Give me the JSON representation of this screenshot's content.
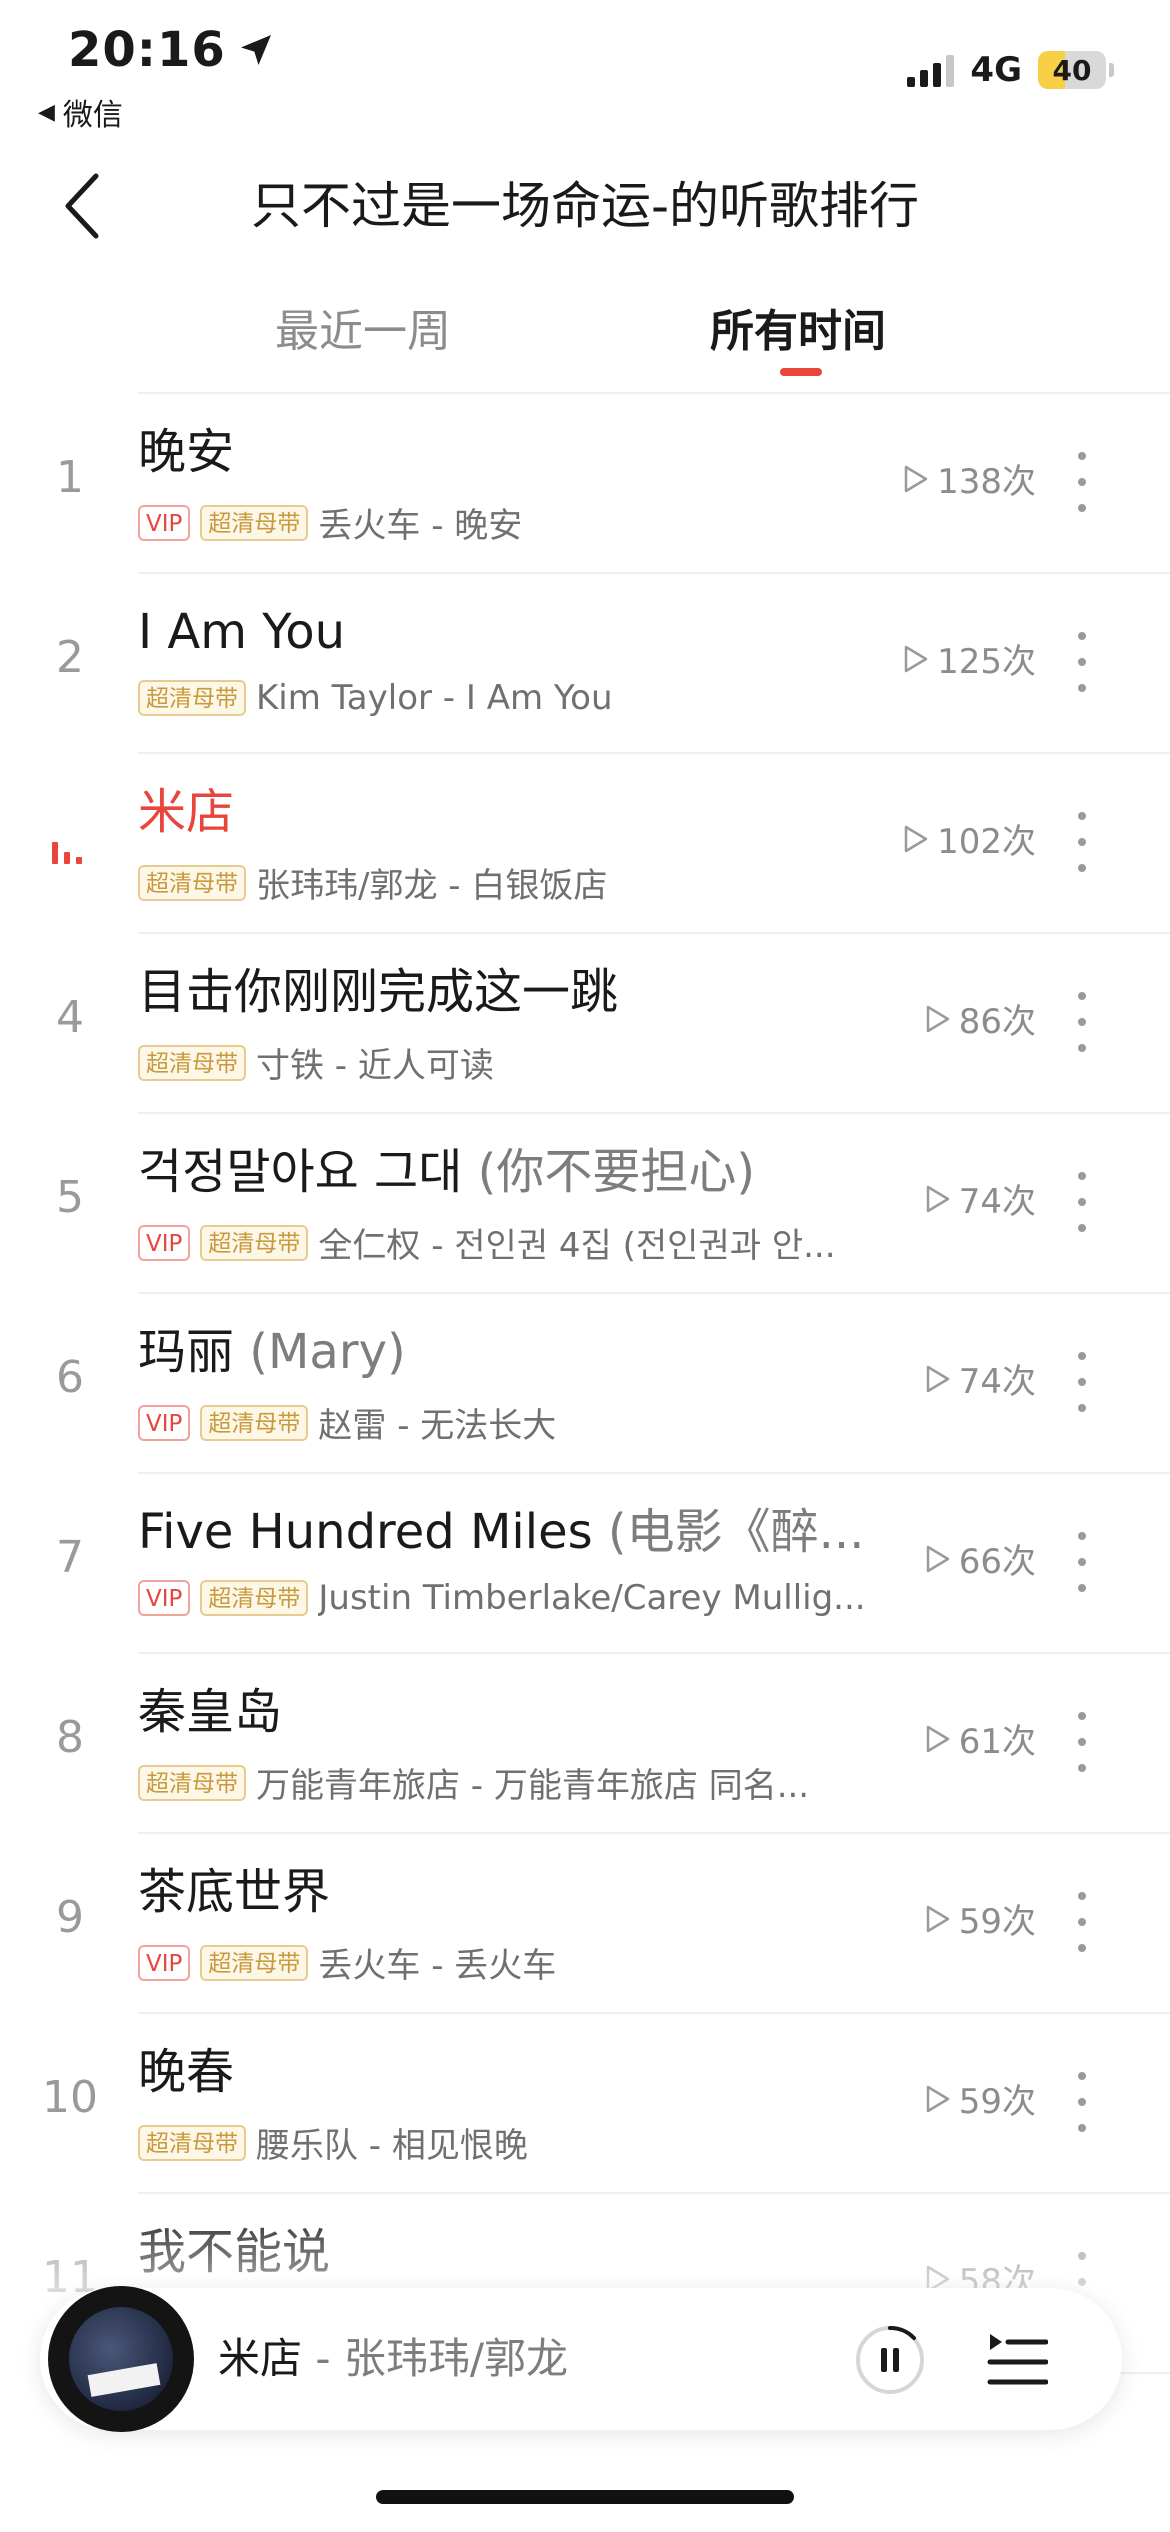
{
  "status_bar": {
    "time": "20:16",
    "back_app": "微信",
    "network": "4G",
    "battery": "40",
    "battery_level": 0.4
  },
  "header": {
    "title": "只不过是一场命运-的听歌排行"
  },
  "tabs": {
    "week": "最近一周",
    "all": "所有时间",
    "selected": "all"
  },
  "songs": [
    {
      "rank": "1",
      "title": "晚安",
      "title_extra": "",
      "vip": true,
      "hq": true,
      "meta": "丢火车 - 晚安",
      "plays": "138次",
      "playing": false
    },
    {
      "rank": "2",
      "title": "I Am You",
      "title_extra": "",
      "vip": false,
      "hq": true,
      "meta": "Kim Taylor - I Am You",
      "plays": "125次",
      "playing": false
    },
    {
      "rank": "3",
      "title": "米店",
      "title_extra": "",
      "vip": false,
      "hq": true,
      "meta": "张玮玮/郭龙 - 白银饭店",
      "plays": "102次",
      "playing": true
    },
    {
      "rank": "4",
      "title": "目击你刚刚完成这一跳",
      "title_extra": "",
      "vip": false,
      "hq": true,
      "meta": "寸铁 - 近人可读",
      "plays": "86次",
      "playing": false
    },
    {
      "rank": "5",
      "title": "걱정말아요 그대",
      "title_extra": " (你不要担心)",
      "vip": true,
      "hq": true,
      "meta": "全仁权 - 전인권 4집 (전인권과 안...",
      "plays": "74次",
      "playing": false
    },
    {
      "rank": "6",
      "title": "玛丽",
      "title_extra": " (Mary)",
      "vip": true,
      "hq": true,
      "meta": "赵雷 - 无法长大",
      "plays": "74次",
      "playing": false
    },
    {
      "rank": "7",
      "title": "Five Hundred Miles",
      "title_extra": " (电影《醉...",
      "vip": true,
      "hq": true,
      "meta": "Justin Timberlake/Carey Mullig...",
      "plays": "66次",
      "playing": false
    },
    {
      "rank": "8",
      "title": "秦皇岛",
      "title_extra": "",
      "vip": false,
      "hq": true,
      "meta": "万能青年旅店 - 万能青年旅店 同名...",
      "plays": "61次",
      "playing": false
    },
    {
      "rank": "9",
      "title": "茶底世界",
      "title_extra": "",
      "vip": true,
      "hq": true,
      "meta": "丢火车 - 丢火车",
      "plays": "59次",
      "playing": false
    },
    {
      "rank": "10",
      "title": "晚春",
      "title_extra": "",
      "vip": false,
      "hq": true,
      "meta": "腰乐队 - 相见恨晚",
      "plays": "59次",
      "playing": false
    },
    {
      "rank": "11",
      "title": "我不能说",
      "title_extra": "",
      "vip": false,
      "hq": false,
      "meta": "",
      "plays": "58次",
      "playing": false
    }
  ],
  "badges": {
    "vip": "VIP",
    "hq": "超清母带"
  },
  "player": {
    "song": "米店",
    "separator": " - ",
    "artist": "张玮玮/郭龙"
  },
  "colors": {
    "accent": "#e8453c",
    "hq_badge": "#c99a3c",
    "muted_text": "#8c8c8c"
  },
  "icons": {
    "location": "location-arrow-icon",
    "back": "chevron-left-icon",
    "play_count": "play-outline-icon",
    "more": "vertical-dots-icon",
    "pause": "pause-icon",
    "queue": "playlist-icon",
    "now_playing": "equalizer-icon"
  }
}
